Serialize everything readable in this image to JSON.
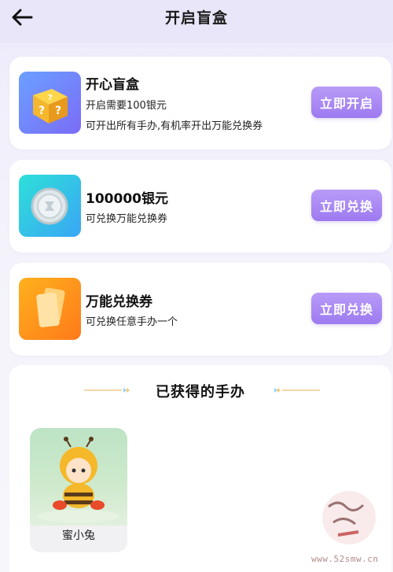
{
  "header": {
    "title": "开启盲盒",
    "back_icon": "arrow-left-icon"
  },
  "cards": [
    {
      "title": "开心盲盒",
      "lines": [
        "开启需要100银元",
        "可开出所有手办,有机率开出万能兑换券"
      ],
      "button": "立即开启",
      "icon": "mystery-box-icon",
      "color": "#7b6cf7"
    },
    {
      "title": "100000银元",
      "lines": [
        "可兑换万能兑换券"
      ],
      "button": "立即兑换",
      "icon": "silver-coin-icon",
      "color": "#2de0d8"
    },
    {
      "title": "万能兑换券",
      "lines": [
        "可兑换任意手办一个"
      ],
      "button": "立即兑换",
      "icon": "voucher-icon",
      "color": "#ff9a1a"
    }
  ],
  "collection": {
    "title": "已获得的手办",
    "items": [
      {
        "name": "蜜小兔",
        "image": "bee-girl-figure"
      }
    ]
  },
  "watermark": {
    "text": "www.52smw.cn"
  },
  "colors": {
    "accent": "#a98af4",
    "background": "#f3f1fb"
  }
}
